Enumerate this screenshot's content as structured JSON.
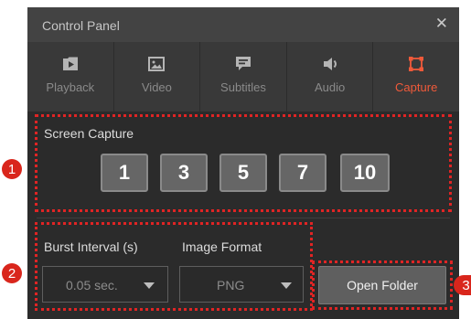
{
  "window": {
    "title": "Control Panel",
    "close_glyph": "✕"
  },
  "tabs": [
    {
      "label": "Playback",
      "icon": "play-icon",
      "active": false
    },
    {
      "label": "Video",
      "icon": "image-icon",
      "active": false
    },
    {
      "label": "Subtitles",
      "icon": "subtitles-icon",
      "active": false
    },
    {
      "label": "Audio",
      "icon": "speaker-icon",
      "active": false
    },
    {
      "label": "Capture",
      "icon": "capture-icon",
      "active": true
    }
  ],
  "screen_capture": {
    "label": "Screen Capture",
    "burst_buttons": [
      "1",
      "3",
      "5",
      "7",
      "10"
    ]
  },
  "options": {
    "burst_interval_label": "Burst Interval (s)",
    "burst_interval_value": "0.05 sec.",
    "image_format_label": "Image Format",
    "image_format_value": "PNG"
  },
  "open_folder_label": "Open Folder",
  "markers": [
    "1",
    "2",
    "3"
  ],
  "colors": {
    "accent": "#f05a3a",
    "highlight_dots": "#e02424",
    "marker": "#d9261c",
    "panel_bg": "#2b2b2b",
    "tab_bg": "#393939",
    "titlebar_bg": "#434343"
  }
}
